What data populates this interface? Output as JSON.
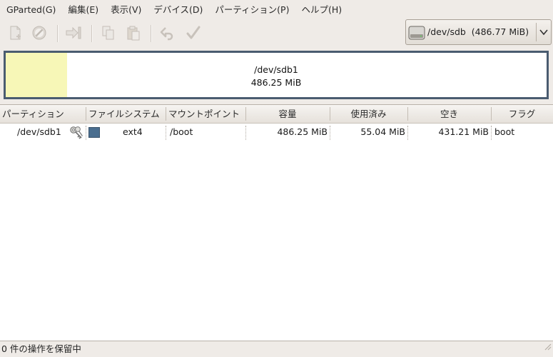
{
  "menubar": {
    "items": [
      {
        "label": "GParted(G)"
      },
      {
        "label": "編集(E)"
      },
      {
        "label": "表示(V)"
      },
      {
        "label": "デバイス(D)"
      },
      {
        "label": "パーティション(P)"
      },
      {
        "label": "ヘルプ(H)"
      }
    ]
  },
  "toolbar": {
    "buttons": [
      {
        "icon": "new-partition-icon",
        "enabled": false
      },
      {
        "icon": "delete-icon",
        "enabled": false
      },
      {
        "icon": "resize-move-icon",
        "enabled": false
      },
      {
        "icon": "copy-icon",
        "enabled": false
      },
      {
        "icon": "paste-icon",
        "enabled": false
      },
      {
        "icon": "undo-icon",
        "enabled": false
      },
      {
        "icon": "apply-icon",
        "enabled": false
      }
    ]
  },
  "device_selector": {
    "label": "/dev/sdb  (486.77 MiB)",
    "icon": "disk-icon"
  },
  "disk_visual": {
    "name": "/dev/sdb1",
    "size": "486.25 MiB",
    "used_fraction": 0.113,
    "used_color": "#f7f7b7",
    "border_color": "#4a5c70"
  },
  "table": {
    "headers": {
      "partition": "パーティション",
      "filesystem": "ファイルシステム",
      "mountpoint": "マウントポイント",
      "size": "容量",
      "used": "使用済み",
      "free": "空き",
      "flags": "フラグ"
    },
    "rows": [
      {
        "partition": "/dev/sdb1",
        "mounted_icon": "key-icon",
        "fs_color": "#4a6e8f",
        "filesystem": "ext4",
        "mountpoint": "/boot",
        "size": "486.25 MiB",
        "used": "55.04 MiB",
        "free": "431.21 MiB",
        "flags": "boot"
      }
    ]
  },
  "statusbar": {
    "text": "0 件の操作を保留中"
  }
}
